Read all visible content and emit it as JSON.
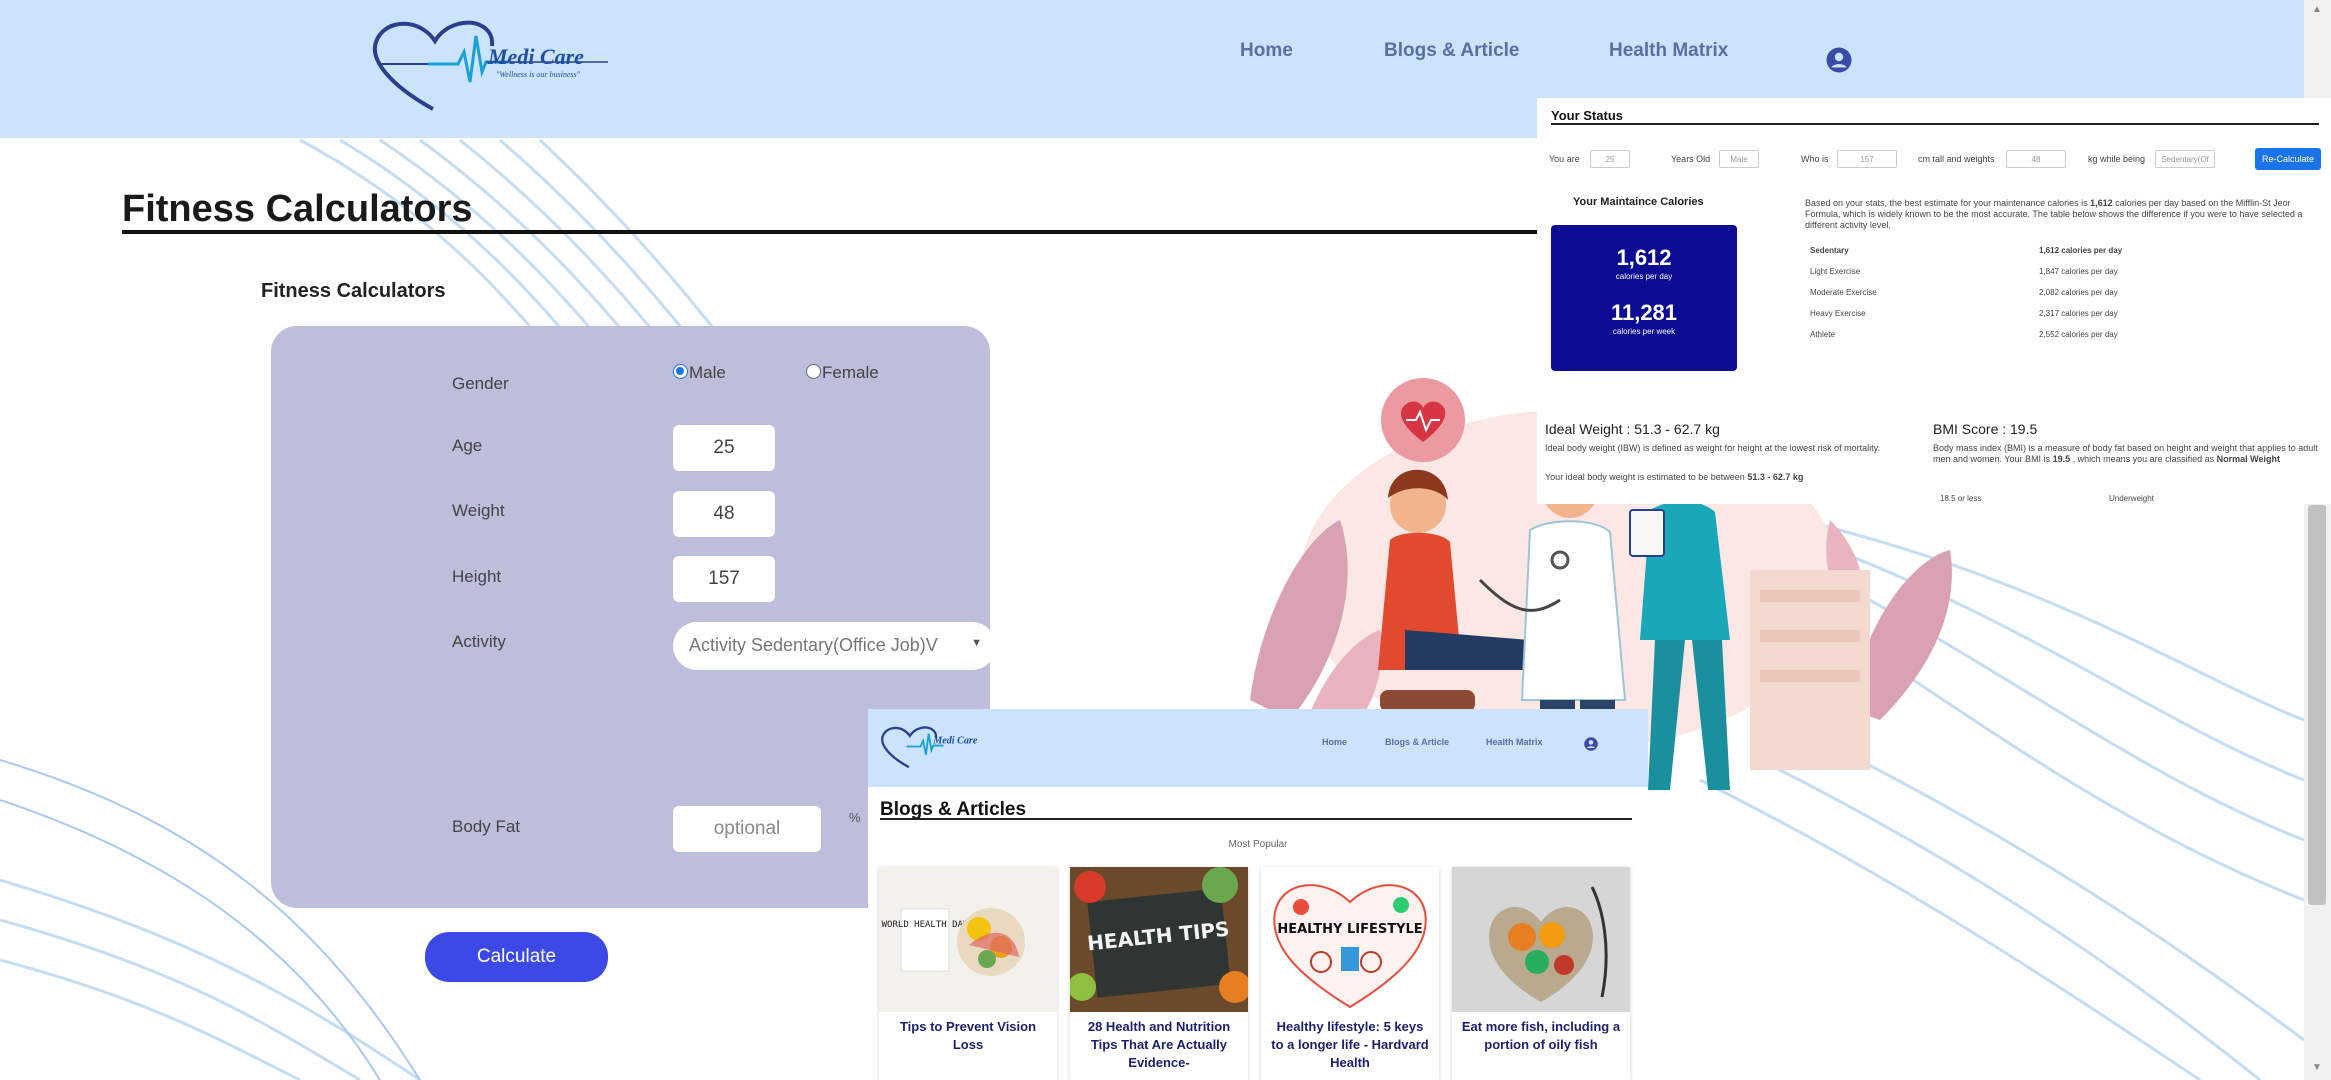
{
  "brand": {
    "name": "Medi Care",
    "tagline": "\"Wellness is our business\""
  },
  "nav": {
    "home": "Home",
    "blogs": "Blogs & Article",
    "health": "Health Matrix"
  },
  "calculator": {
    "page_title": "Fitness Calculators",
    "section_title": "Fitness Calculators",
    "gender_label": "Gender",
    "gender_options": {
      "male": "Male",
      "female": "Female"
    },
    "gender_selected": "Male",
    "age_label": "Age",
    "age_value": "25",
    "weight_label": "Weight",
    "weight_value": "48",
    "height_label": "Height",
    "height_value": "157",
    "activity_label": "Activity",
    "activity_value": "Activity Sedentary(Office Job)V",
    "bodyfat_label": "Body Fat",
    "bodyfat_placeholder": "optional",
    "bodyfat_unit": "%",
    "calculate_button": "Calculate"
  },
  "status": {
    "title": "Your Status",
    "you_are": "You are",
    "age": "25",
    "years_old": "Years Old",
    "gender": "Male",
    "who_is": "Who is",
    "height": "157",
    "cm_tall": "cm tall and weights",
    "weight": "48",
    "kg_while": "kg while being",
    "activity": "Sedentary(Of",
    "recalc_button": "Re-Calculate",
    "maint_title": "Your Maintaince Calories",
    "cal_day": "1,612",
    "cal_day_unit": "calories per day",
    "cal_week": "11,281",
    "cal_week_unit": "calories per week",
    "para_1": "Based on your stats, the best estimate for your maintenance calories is ",
    "para_bold": "1,612",
    "para_2": " calories per day based on the Mifflin-St Jeor Formula, which is widely known to be the most accurate. The table below shows the difference if you were to have selected a different activity level.",
    "activity_levels": [
      {
        "name": "Sedentary",
        "value": "1,612 calories per day"
      },
      {
        "name": "Light Exercise",
        "value": "1,847 calories per day"
      },
      {
        "name": "Moderate Exercise",
        "value": "2,082 calories per day"
      },
      {
        "name": "Heavy Exercise",
        "value": "2,317 calories per day"
      },
      {
        "name": "Athlete",
        "value": "2,552 calories per day"
      }
    ],
    "ideal_title": "Ideal Weight : 51.3 - 62.7 kg",
    "ideal_desc": "Ideal body weight (IBW) is defined as weight for height at the lowest risk of mortality.",
    "ideal_est_1": "Your ideal body weight is estimated to be between ",
    "ideal_est_bold": "51.3 - 62.7 kg",
    "bmi_title": "BMI Score : 19.5",
    "bmi_desc_1": "Body mass index (BMI) is a measure of body fat based on height and weight that applies to adult men and women. Your BMI is ",
    "bmi_bold": "19.5",
    "bmi_desc_2": " , which means you are classified as ",
    "bmi_class": "Normal Weight",
    "bmi_row_range": "18.5 or less",
    "bmi_row_label": "Underweight"
  },
  "blogs": {
    "nav_home": "Home",
    "nav_blogs": "Blogs & Article",
    "nav_health": "Health Matrix",
    "title": "Blogs & Articles",
    "most_popular": "Most Popular",
    "cards": [
      {
        "caption": "Tips to Prevent Vision Loss",
        "image_text": "WORLD HEALTH DAY"
      },
      {
        "caption": "28 Health and Nutrition Tips That Are Actually Evidence-",
        "image_text": "HEALTH TIPS"
      },
      {
        "caption": "Healthy lifestyle: 5 keys to a longer life - Hardvard Health",
        "image_text": "HEALTHY LIFESTYLE"
      },
      {
        "caption": "Eat more fish, including a portion of oily fish",
        "image_text": ""
      }
    ]
  },
  "colors": {
    "header_bg": "#cbe3fb",
    "card_bg": "#bcbedb",
    "button_blue": "#3d49e6",
    "calorie_box": "#0b0c91",
    "caption_navy": "#1b1f6e"
  }
}
